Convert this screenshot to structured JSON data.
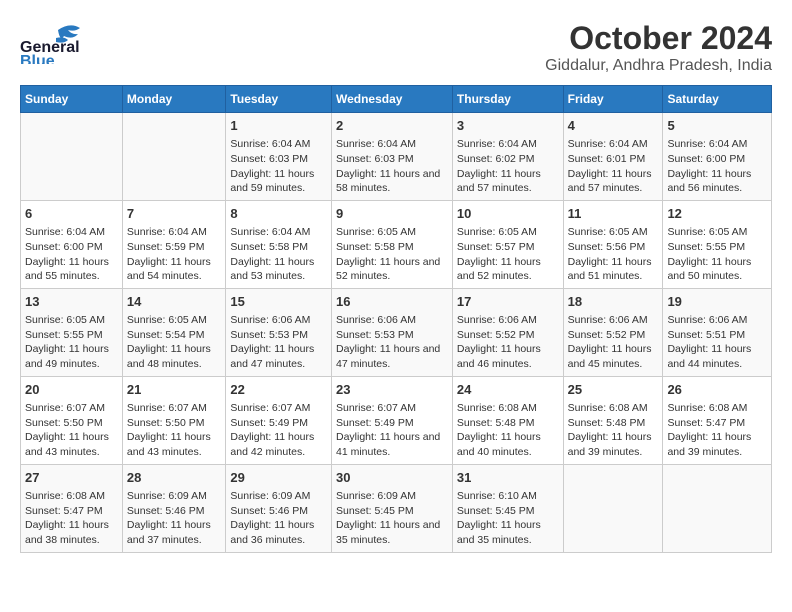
{
  "logo": {
    "line1": "General",
    "line2": "Blue"
  },
  "title": "October 2024",
  "subtitle": "Giddalur, Andhra Pradesh, India",
  "headers": [
    "Sunday",
    "Monday",
    "Tuesday",
    "Wednesday",
    "Thursday",
    "Friday",
    "Saturday"
  ],
  "weeks": [
    [
      {
        "day": "",
        "info": ""
      },
      {
        "day": "",
        "info": ""
      },
      {
        "day": "1",
        "info": "Sunrise: 6:04 AM\nSunset: 6:03 PM\nDaylight: 11 hours and 59 minutes."
      },
      {
        "day": "2",
        "info": "Sunrise: 6:04 AM\nSunset: 6:03 PM\nDaylight: 11 hours and 58 minutes."
      },
      {
        "day": "3",
        "info": "Sunrise: 6:04 AM\nSunset: 6:02 PM\nDaylight: 11 hours and 57 minutes."
      },
      {
        "day": "4",
        "info": "Sunrise: 6:04 AM\nSunset: 6:01 PM\nDaylight: 11 hours and 57 minutes."
      },
      {
        "day": "5",
        "info": "Sunrise: 6:04 AM\nSunset: 6:00 PM\nDaylight: 11 hours and 56 minutes."
      }
    ],
    [
      {
        "day": "6",
        "info": "Sunrise: 6:04 AM\nSunset: 6:00 PM\nDaylight: 11 hours and 55 minutes."
      },
      {
        "day": "7",
        "info": "Sunrise: 6:04 AM\nSunset: 5:59 PM\nDaylight: 11 hours and 54 minutes."
      },
      {
        "day": "8",
        "info": "Sunrise: 6:04 AM\nSunset: 5:58 PM\nDaylight: 11 hours and 53 minutes."
      },
      {
        "day": "9",
        "info": "Sunrise: 6:05 AM\nSunset: 5:58 PM\nDaylight: 11 hours and 52 minutes."
      },
      {
        "day": "10",
        "info": "Sunrise: 6:05 AM\nSunset: 5:57 PM\nDaylight: 11 hours and 52 minutes."
      },
      {
        "day": "11",
        "info": "Sunrise: 6:05 AM\nSunset: 5:56 PM\nDaylight: 11 hours and 51 minutes."
      },
      {
        "day": "12",
        "info": "Sunrise: 6:05 AM\nSunset: 5:55 PM\nDaylight: 11 hours and 50 minutes."
      }
    ],
    [
      {
        "day": "13",
        "info": "Sunrise: 6:05 AM\nSunset: 5:55 PM\nDaylight: 11 hours and 49 minutes."
      },
      {
        "day": "14",
        "info": "Sunrise: 6:05 AM\nSunset: 5:54 PM\nDaylight: 11 hours and 48 minutes."
      },
      {
        "day": "15",
        "info": "Sunrise: 6:06 AM\nSunset: 5:53 PM\nDaylight: 11 hours and 47 minutes."
      },
      {
        "day": "16",
        "info": "Sunrise: 6:06 AM\nSunset: 5:53 PM\nDaylight: 11 hours and 47 minutes."
      },
      {
        "day": "17",
        "info": "Sunrise: 6:06 AM\nSunset: 5:52 PM\nDaylight: 11 hours and 46 minutes."
      },
      {
        "day": "18",
        "info": "Sunrise: 6:06 AM\nSunset: 5:52 PM\nDaylight: 11 hours and 45 minutes."
      },
      {
        "day": "19",
        "info": "Sunrise: 6:06 AM\nSunset: 5:51 PM\nDaylight: 11 hours and 44 minutes."
      }
    ],
    [
      {
        "day": "20",
        "info": "Sunrise: 6:07 AM\nSunset: 5:50 PM\nDaylight: 11 hours and 43 minutes."
      },
      {
        "day": "21",
        "info": "Sunrise: 6:07 AM\nSunset: 5:50 PM\nDaylight: 11 hours and 43 minutes."
      },
      {
        "day": "22",
        "info": "Sunrise: 6:07 AM\nSunset: 5:49 PM\nDaylight: 11 hours and 42 minutes."
      },
      {
        "day": "23",
        "info": "Sunrise: 6:07 AM\nSunset: 5:49 PM\nDaylight: 11 hours and 41 minutes."
      },
      {
        "day": "24",
        "info": "Sunrise: 6:08 AM\nSunset: 5:48 PM\nDaylight: 11 hours and 40 minutes."
      },
      {
        "day": "25",
        "info": "Sunrise: 6:08 AM\nSunset: 5:48 PM\nDaylight: 11 hours and 39 minutes."
      },
      {
        "day": "26",
        "info": "Sunrise: 6:08 AM\nSunset: 5:47 PM\nDaylight: 11 hours and 39 minutes."
      }
    ],
    [
      {
        "day": "27",
        "info": "Sunrise: 6:08 AM\nSunset: 5:47 PM\nDaylight: 11 hours and 38 minutes."
      },
      {
        "day": "28",
        "info": "Sunrise: 6:09 AM\nSunset: 5:46 PM\nDaylight: 11 hours and 37 minutes."
      },
      {
        "day": "29",
        "info": "Sunrise: 6:09 AM\nSunset: 5:46 PM\nDaylight: 11 hours and 36 minutes."
      },
      {
        "day": "30",
        "info": "Sunrise: 6:09 AM\nSunset: 5:45 PM\nDaylight: 11 hours and 35 minutes."
      },
      {
        "day": "31",
        "info": "Sunrise: 6:10 AM\nSunset: 5:45 PM\nDaylight: 11 hours and 35 minutes."
      },
      {
        "day": "",
        "info": ""
      },
      {
        "day": "",
        "info": ""
      }
    ]
  ]
}
